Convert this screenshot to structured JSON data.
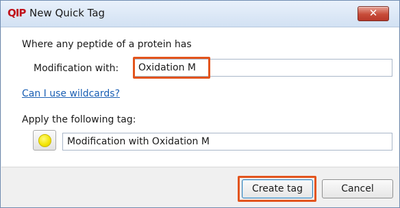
{
  "window": {
    "app_logo": "QIP",
    "title": "New Quick Tag",
    "close_glyph": "✕"
  },
  "form": {
    "condition_heading": "Where any peptide of a protein has",
    "modification_label": "Modification with:",
    "modification_value": "Oxidation M",
    "wildcards_link": "Can I use wildcards?",
    "tag_heading": "Apply the following tag:",
    "tag_color_icon": "yellow-circle-icon",
    "tag_color": "#f2e400",
    "tag_name_value": "Modification with Oxidation M"
  },
  "footer": {
    "create_label": "Create tag",
    "cancel_label": "Cancel"
  },
  "highlights": {
    "color": "#e3541c"
  }
}
